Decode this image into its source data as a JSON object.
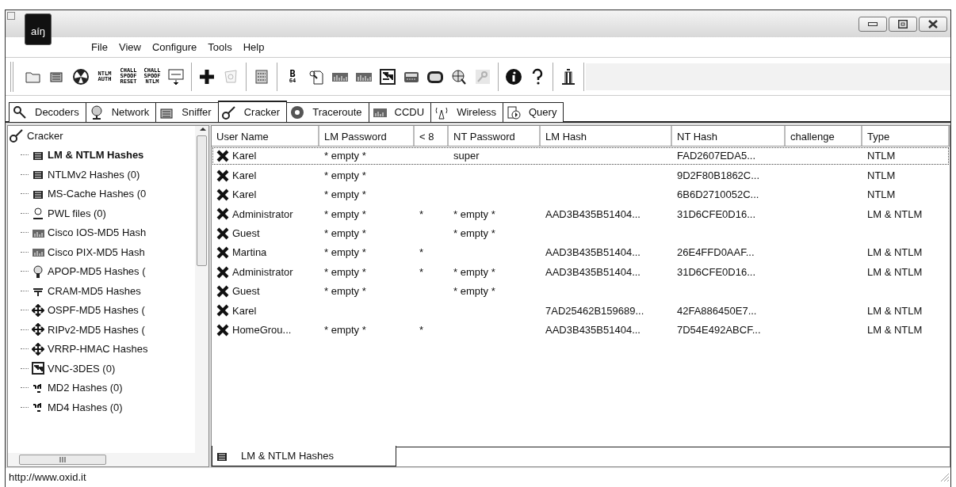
{
  "window": {
    "title_logo": "aíŋ"
  },
  "menu": [
    {
      "label": "File"
    },
    {
      "label": "View"
    },
    {
      "label": "Configure"
    },
    {
      "label": "Tools"
    },
    {
      "label": "Help"
    }
  ],
  "toolbar": {
    "groups": [
      [
        {
          "kind": "icon",
          "disabled": false
        },
        {
          "kind": "icon",
          "disabled": false
        },
        {
          "kind": "icon",
          "disabled": false
        },
        {
          "kind": "text",
          "lines": [
            "NTLM",
            "AUTH"
          ],
          "disabled": false
        },
        {
          "kind": "text",
          "lines": [
            "CHALL",
            "SPOOF",
            "RESET"
          ],
          "disabled": false
        },
        {
          "kind": "text",
          "lines": [
            "CHALL",
            "SPOOF",
            "NTLM"
          ],
          "disabled": false
        },
        {
          "kind": "icon",
          "disabled": false
        }
      ],
      [
        {
          "kind": "icon",
          "disabled": false
        },
        {
          "kind": "icon",
          "disabled": true
        }
      ],
      [
        {
          "kind": "icon",
          "disabled": false
        }
      ],
      [
        {
          "kind": "text",
          "lines": [
            "B",
            "64"
          ],
          "disabled": false
        },
        {
          "kind": "icon",
          "disabled": false
        },
        {
          "kind": "icon",
          "disabled": false
        },
        {
          "kind": "icon",
          "disabled": false
        },
        {
          "kind": "icon",
          "disabled": false
        },
        {
          "kind": "icon",
          "disabled": false
        },
        {
          "kind": "icon",
          "disabled": false
        },
        {
          "kind": "icon",
          "disabled": false
        },
        {
          "kind": "icon",
          "disabled": true
        }
      ],
      [
        {
          "kind": "icon",
          "disabled": false
        },
        {
          "kind": "icon",
          "disabled": false
        }
      ],
      [
        {
          "kind": "icon",
          "disabled": false
        }
      ]
    ]
  },
  "tabs": [
    {
      "label": "Decoders",
      "selected": false
    },
    {
      "label": "Network",
      "selected": false
    },
    {
      "label": "Sniffer",
      "selected": false
    },
    {
      "label": "Cracker",
      "selected": true
    },
    {
      "label": "Traceroute",
      "selected": false
    },
    {
      "label": "CCDU",
      "selected": false
    },
    {
      "label": "Wireless",
      "selected": false
    },
    {
      "label": "Query",
      "selected": false
    }
  ],
  "tree": {
    "label": "Cracker",
    "children": [
      {
        "label": "LM & NTLM Hashes",
        "selected": true
      },
      {
        "label": "NTLMv2 Hashes (0)",
        "selected": false
      },
      {
        "label": "MS-Cache Hashes (0",
        "selected": false
      },
      {
        "label": "PWL files (0)",
        "selected": false
      },
      {
        "label": "Cisco IOS-MD5 Hash",
        "selected": false
      },
      {
        "label": "Cisco PIX-MD5 Hash",
        "selected": false
      },
      {
        "label": "APOP-MD5 Hashes (",
        "selected": false
      },
      {
        "label": "CRAM-MD5 Hashes",
        "selected": false
      },
      {
        "label": "OSPF-MD5 Hashes (",
        "selected": false
      },
      {
        "label": "RIPv2-MD5 Hashes (",
        "selected": false
      },
      {
        "label": "VRRP-HMAC Hashes",
        "selected": false
      },
      {
        "label": "VNC-3DES (0)",
        "selected": false
      },
      {
        "label": "MD2 Hashes (0)",
        "selected": false
      },
      {
        "label": "MD4 Hashes (0)",
        "selected": false
      }
    ]
  },
  "table": {
    "columns": [
      "User Name",
      "LM Password",
      "< 8",
      "NT Password",
      "LM Hash",
      "NT Hash",
      "challenge",
      "Type"
    ],
    "rows": [
      {
        "focused": true,
        "cells": [
          "Karel",
          "* empty *",
          "",
          "super",
          "",
          "FAD2607EDA5...",
          "",
          "NTLM"
        ]
      },
      {
        "focused": false,
        "cells": [
          "Karel",
          "* empty *",
          "",
          "",
          "",
          "9D2F80B1862C...",
          "",
          "NTLM"
        ]
      },
      {
        "focused": false,
        "cells": [
          "Karel",
          "* empty *",
          "",
          "",
          "",
          "6B6D2710052C...",
          "",
          "NTLM"
        ]
      },
      {
        "focused": false,
        "cells": [
          "Administrator",
          "* empty *",
          "*",
          "* empty *",
          "AAD3B435B51404...",
          "31D6CFE0D16...",
          "",
          "LM & NTLM"
        ]
      },
      {
        "focused": false,
        "cells": [
          "Guest",
          "* empty *",
          "",
          "* empty *",
          "",
          "",
          "",
          ""
        ]
      },
      {
        "focused": false,
        "cells": [
          "Martina",
          "* empty *",
          "*",
          "",
          "AAD3B435B51404...",
          "26E4FFD0AAF...",
          "",
          "LM & NTLM"
        ]
      },
      {
        "focused": false,
        "cells": [
          "Administrator",
          "* empty *",
          "*",
          "* empty *",
          "AAD3B435B51404...",
          "31D6CFE0D16...",
          "",
          "LM & NTLM"
        ]
      },
      {
        "focused": false,
        "cells": [
          "Guest",
          "* empty *",
          "",
          "* empty *",
          "",
          "",
          "",
          ""
        ]
      },
      {
        "focused": false,
        "cells": [
          "Karel",
          "",
          "",
          "",
          "7AD25462B159689...",
          "42FA886450E7...",
          "",
          "LM & NTLM"
        ]
      },
      {
        "focused": false,
        "cells": [
          "HomeGrou...",
          "* empty *",
          "*",
          "",
          "AAD3B435B51404...",
          "7D54E492ABCF...",
          "",
          "LM & NTLM"
        ]
      }
    ]
  },
  "bottom_tab": {
    "label": "LM & NTLM Hashes"
  },
  "status_bar": "http://www.oxid.it"
}
